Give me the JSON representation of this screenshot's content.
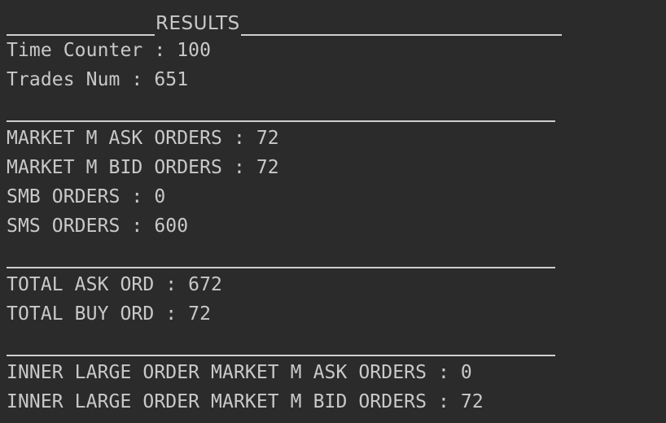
{
  "header": {
    "title": "RESULTS"
  },
  "summary": [
    "Time Counter : 100",
    "Trades Num : 651"
  ],
  "market_orders": [
    "MARKET M ASK ORDERS : 72",
    "MARKET M BID ORDERS : 72",
    "SMB ORDERS : 0",
    "SMS ORDERS : 600"
  ],
  "totals": [
    "TOTAL ASK ORD : 672",
    "TOTAL BUY ORD : 72"
  ],
  "inner_large": [
    "INNER LARGE ORDER MARKET M ASK ORDERS : 0",
    "INNER LARGE ORDER MARKET M BID ORDERS : 72"
  ],
  "colors": {
    "background": "#2b2b2b",
    "text": "#c9c9c9",
    "rule": "#cfcfcf"
  }
}
